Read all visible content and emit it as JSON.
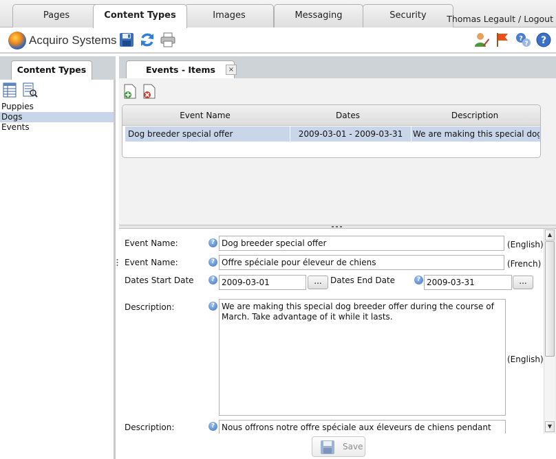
{
  "top_tabs": [
    "Pages",
    "Content Types",
    "Images",
    "Messaging",
    "Security"
  ],
  "user_link": "Thomas Legault / Logout",
  "logo_text": "Acquiro Systems",
  "left_panel": {
    "tab_label": "Content Types",
    "items": [
      "Puppies",
      "Dogs",
      "Events"
    ],
    "selected": "Dogs"
  },
  "right_panel": {
    "tab_label": "Events - Items",
    "close_glyph": "×",
    "grid": {
      "columns": [
        "Event Name",
        "Dates",
        "Description"
      ],
      "rows": [
        {
          "event_name": "Dog breeder special offer",
          "dates": "2009-03-01 - 2009-03-31",
          "description": "We are making this special dog"
        }
      ]
    },
    "form": {
      "event_name_label": "Event Name:",
      "event_name_en": "Dog breeder special offer",
      "event_name_fr_label": "Event Name:",
      "event_name_fr": "Offre spéciale pour éleveur de chiens",
      "lang_english": "(English)",
      "lang_french": "(French)",
      "dates_start_label": "Dates Start Date",
      "dates_start": "2009-03-01",
      "dates_end_label": "Dates End Date",
      "dates_end": "2009-03-31",
      "browse_label": "...",
      "description_label": "Description:",
      "description_en": "We are making this special dog breeder offer during the course of March. Take advantage of it while it lasts.",
      "description_fr_label": "Description:",
      "description_fr": "Nous offrons notre offre spéciale aux éleveurs de chiens pendant tout le mois de mars. Profitez-en pendant que ça dure.",
      "help_glyph": "?"
    },
    "save_label": "Save"
  },
  "colors": {
    "selection": "#c9d6ea",
    "panel_strip": "#cdd3d6",
    "accent_blue": "#2b64b8"
  }
}
